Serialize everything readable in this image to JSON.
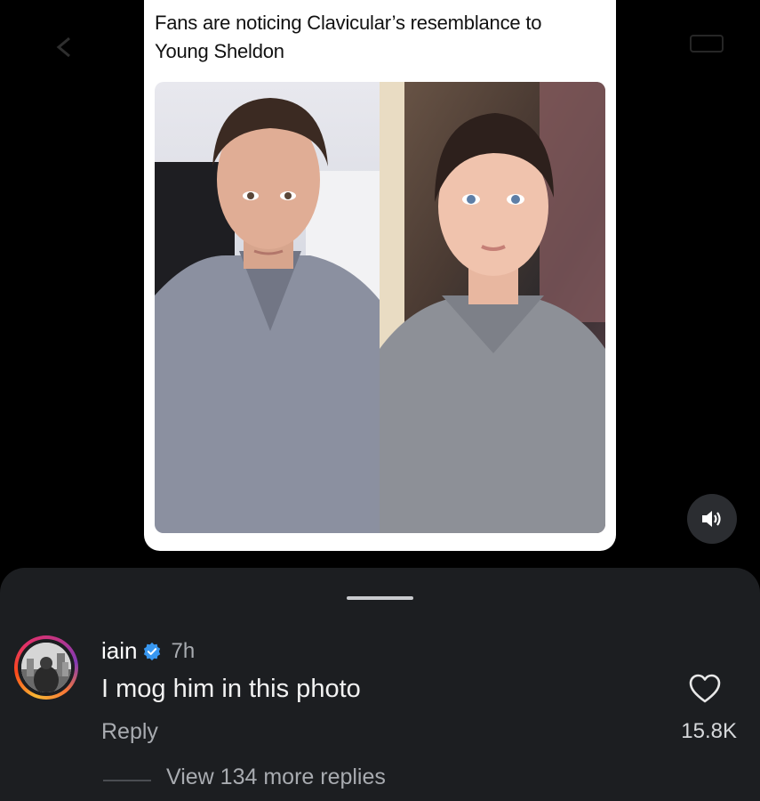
{
  "post": {
    "caption": "Fans are noticing Clavicular’s resemblance to Young Sheldon"
  },
  "media": {
    "sound_icon": "speaker-volume-icon"
  },
  "comment": {
    "username": "iain",
    "timestamp": "7h",
    "text": "I mog him in this photo",
    "reply_label": "Reply",
    "like_count": "15.8K",
    "view_replies_label": "View 134 more replies",
    "verified_icon": "verified-badge-icon",
    "like_icon": "heart-outline-icon"
  },
  "colors": {
    "sheet_background": "#1c1e21",
    "verified_blue": "#3897f0",
    "secondary_text": "#a8abb0"
  }
}
